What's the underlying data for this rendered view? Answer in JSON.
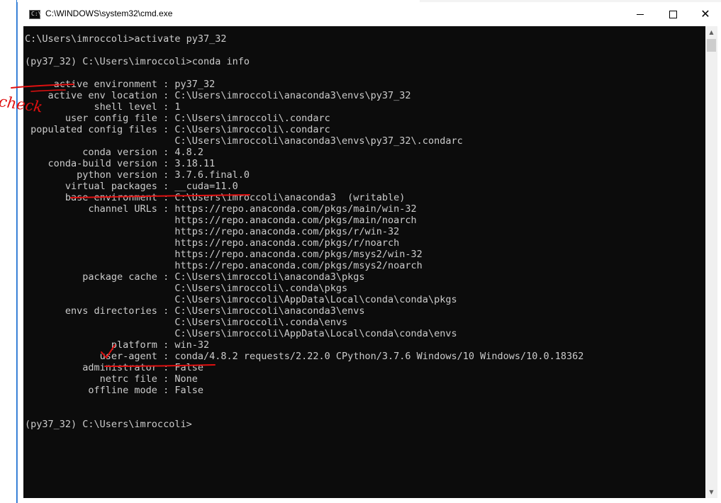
{
  "window": {
    "title": "C:\\WINDOWS\\system32\\cmd.exe",
    "icon": "cmd-icon",
    "controls": [
      "minimize-icon",
      "maximize-icon",
      "close-icon"
    ]
  },
  "console": {
    "lines": [
      "C:\\Users\\imroccoli>activate py37_32",
      "",
      "(py37_32) C:\\Users\\imroccoli>conda info",
      "",
      "     active environment : py37_32",
      "    active env location : C:\\Users\\imroccoli\\anaconda3\\envs\\py37_32",
      "            shell level : 1",
      "       user config file : C:\\Users\\imroccoli\\.condarc",
      " populated config files : C:\\Users\\imroccoli\\.condarc",
      "                          C:\\Users\\imroccoli\\anaconda3\\envs\\py37_32\\.condarc",
      "          conda version : 4.8.2",
      "    conda-build version : 3.18.11",
      "         python version : 3.7.6.final.0",
      "       virtual packages : __cuda=11.0",
      "       base environment : C:\\Users\\imroccoli\\anaconda3  (writable)",
      "           channel URLs : https://repo.anaconda.com/pkgs/main/win-32",
      "                          https://repo.anaconda.com/pkgs/main/noarch",
      "                          https://repo.anaconda.com/pkgs/r/win-32",
      "                          https://repo.anaconda.com/pkgs/r/noarch",
      "                          https://repo.anaconda.com/pkgs/msys2/win-32",
      "                          https://repo.anaconda.com/pkgs/msys2/noarch",
      "          package cache : C:\\Users\\imroccoli\\anaconda3\\pkgs",
      "                          C:\\Users\\imroccoli\\.conda\\pkgs",
      "                          C:\\Users\\imroccoli\\AppData\\Local\\conda\\conda\\pkgs",
      "       envs directories : C:\\Users\\imroccoli\\anaconda3\\envs",
      "                          C:\\Users\\imroccoli\\.conda\\envs",
      "                          C:\\Users\\imroccoli\\AppData\\Local\\conda\\conda\\envs",
      "               platform : win-32",
      "             user-agent : conda/4.8.2 requests/2.22.0 CPython/3.7.6 Windows/10 Windows/10.0.18362",
      "          administrator : False",
      "             netrc file : None",
      "           offline mode : False",
      "",
      "",
      "(py37_32) C:\\Users\\imroccoli>"
    ]
  },
  "annotations": {
    "check_label": "check",
    "color": "#e01010"
  },
  "colors": {
    "console_bg": "#0c0c0c",
    "console_fg": "#cccccc",
    "annotation": "#e01010"
  }
}
